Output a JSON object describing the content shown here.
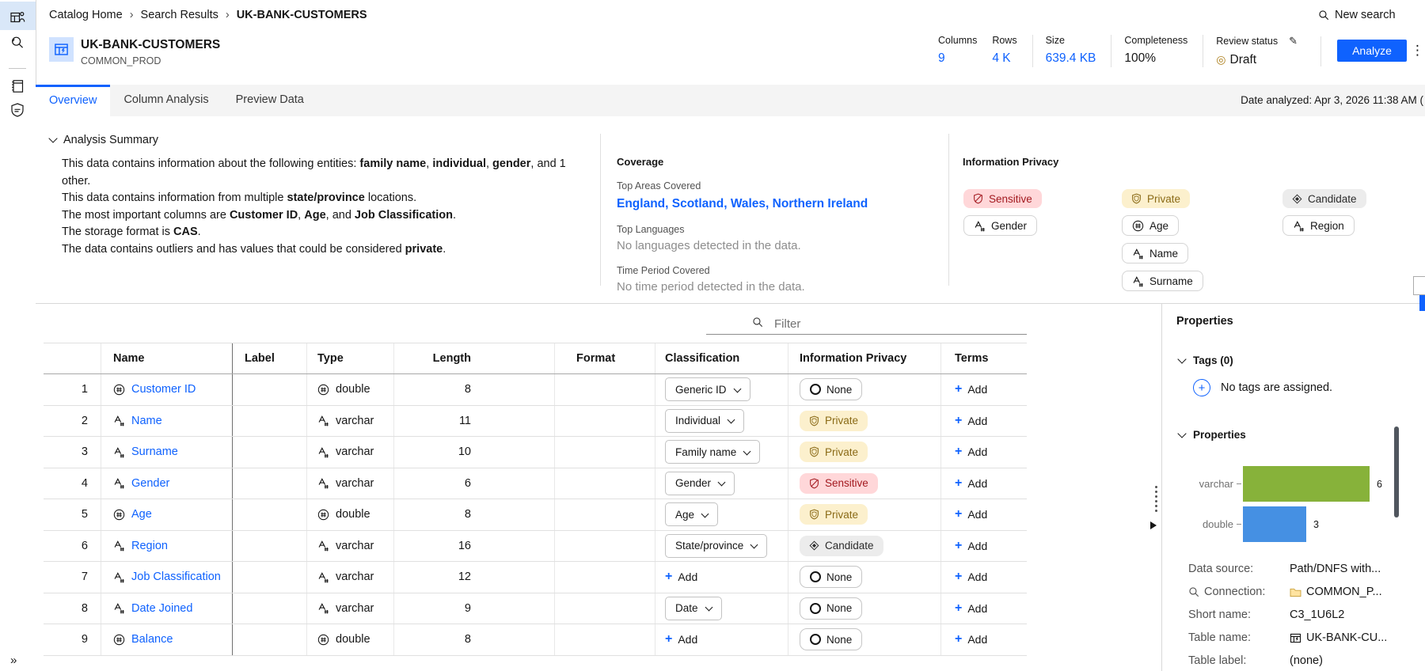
{
  "glyphs": {
    "breadcrumb_sep": "›",
    "kebab": "⋮",
    "pencil": "✎",
    "draft_icon": "◎",
    "expand": "»",
    "plus": "+"
  },
  "colors": {
    "accent": "#0f62fe",
    "sensitive_bg": "#ffd7d9",
    "sensitive_fg": "#a2191f",
    "private_bg": "#fcf0cd",
    "private_fg": "#8a6a16",
    "candidate_bg": "#ececec",
    "bar_green": "#87b23a",
    "bar_blue": "#4590e3",
    "scrollbar": "#50565e"
  },
  "sidebar": {
    "items": [
      {
        "id": "catalog",
        "icon": "catalog-icon",
        "selected": true
      },
      {
        "id": "discovery",
        "icon": "search-discovery-icon",
        "selected": false
      },
      {
        "id": "notebook",
        "icon": "notebook-icon",
        "selected": false
      },
      {
        "id": "governance",
        "icon": "governance-shield-icon",
        "selected": false
      }
    ],
    "expand_label": "»"
  },
  "breadcrumb": [
    "Catalog Home",
    "Search Results",
    "UK-BANK-CUSTOMERS"
  ],
  "top_right": {
    "new_search": "New search"
  },
  "header": {
    "title": "UK-BANK-CUSTOMERS",
    "subtitle": "COMMON_PROD",
    "stats": [
      {
        "label": "Columns",
        "value": "9",
        "link": true,
        "divider": false
      },
      {
        "label": "Rows",
        "value": "4 K",
        "link": true,
        "divider": false
      },
      {
        "label": "Size",
        "value": "639.4 KB",
        "link": true,
        "divider": true
      },
      {
        "label": "Completeness",
        "value": "100%",
        "link": false,
        "divider": true
      }
    ],
    "review_status": {
      "label": "Review status",
      "value": "Draft"
    },
    "analyze_button": "Analyze"
  },
  "tabs": [
    {
      "label": "Overview",
      "selected": true
    },
    {
      "label": "Column Analysis",
      "selected": false
    },
    {
      "label": "Preview Data",
      "selected": false
    }
  ],
  "date_analyzed": "Date analyzed: Apr 3, 2026 11:38 AM  (",
  "analysis_summary": {
    "title": "Analysis Summary",
    "lines": [
      [
        {
          "t": "This data contains information about the following entities: "
        },
        {
          "t": "family name",
          "b": true
        },
        {
          "t": ", "
        },
        {
          "t": "individual",
          "b": true
        },
        {
          "t": ", "
        },
        {
          "t": "gender",
          "b": true
        },
        {
          "t": ", and 1 other."
        }
      ],
      [
        {
          "t": "This data contains information from multiple "
        },
        {
          "t": "state/province",
          "b": true
        },
        {
          "t": " locations."
        }
      ],
      [
        {
          "t": "The most important columns are "
        },
        {
          "t": "Customer ID",
          "b": true
        },
        {
          "t": ", "
        },
        {
          "t": "Age",
          "b": true
        },
        {
          "t": ", and "
        },
        {
          "t": "Job Classification",
          "b": true
        },
        {
          "t": "."
        }
      ],
      [
        {
          "t": "The storage format is "
        },
        {
          "t": "CAS",
          "b": true
        },
        {
          "t": "."
        }
      ],
      [
        {
          "t": "The data contains outliers and has values that could be considered "
        },
        {
          "t": "private",
          "b": true
        },
        {
          "t": "."
        }
      ]
    ]
  },
  "coverage": {
    "title": "Coverage",
    "top_areas_label": "Top Areas Covered",
    "top_areas": "England, Scotland, Wales, Northern Ireland",
    "top_languages_label": "Top Languages",
    "top_languages": "No languages detected in the data.",
    "time_period_label": "Time Period Covered",
    "time_period": "No time period detected in the data."
  },
  "information_privacy": {
    "title": "Information Privacy",
    "columns": [
      [
        {
          "label": "Sensitive",
          "variant": "sensitive",
          "icon": "shield-slash-icon"
        },
        {
          "label": "Gender",
          "variant": "plain",
          "icon": "string-type-icon"
        }
      ],
      [
        {
          "label": "Private",
          "variant": "private",
          "icon": "shield-icon"
        },
        {
          "label": "Age",
          "variant": "plain",
          "icon": "numeric-type-icon"
        },
        {
          "label": "Name",
          "variant": "plain",
          "icon": "string-type-icon"
        },
        {
          "label": "Surname",
          "variant": "plain",
          "icon": "string-type-icon"
        }
      ],
      [
        {
          "label": "Candidate",
          "variant": "candidate",
          "icon": "diamond-icon"
        },
        {
          "label": "Region",
          "variant": "plain",
          "icon": "string-type-icon"
        }
      ]
    ]
  },
  "columns_table": {
    "filter_placeholder": "Filter",
    "headers": [
      "Name",
      "Label",
      "Type",
      "Length",
      "Format",
      "Classification",
      "Information Privacy",
      "Terms"
    ],
    "add_label": "Add",
    "rows": [
      {
        "num": "1",
        "name": "Customer ID",
        "type_kind": "numeric",
        "type": "double",
        "length": "8",
        "classification": {
          "kind": "select",
          "value": "Generic ID"
        },
        "privacy": {
          "label": "None",
          "variant": "none"
        }
      },
      {
        "num": "2",
        "name": "Name",
        "type_kind": "string",
        "type": "varchar",
        "length": "11",
        "classification": {
          "kind": "select",
          "value": "Individual"
        },
        "privacy": {
          "label": "Private",
          "variant": "private"
        }
      },
      {
        "num": "3",
        "name": "Surname",
        "type_kind": "string",
        "type": "varchar",
        "length": "10",
        "classification": {
          "kind": "select",
          "value": "Family name"
        },
        "privacy": {
          "label": "Private",
          "variant": "private"
        }
      },
      {
        "num": "4",
        "name": "Gender",
        "type_kind": "string",
        "type": "varchar",
        "length": "6",
        "classification": {
          "kind": "select",
          "value": "Gender"
        },
        "privacy": {
          "label": "Sensitive",
          "variant": "sensitive"
        }
      },
      {
        "num": "5",
        "name": "Age",
        "type_kind": "numeric",
        "type": "double",
        "length": "8",
        "classification": {
          "kind": "select",
          "value": "Age"
        },
        "privacy": {
          "label": "Private",
          "variant": "private"
        }
      },
      {
        "num": "6",
        "name": "Region",
        "type_kind": "string",
        "type": "varchar",
        "length": "16",
        "classification": {
          "kind": "select",
          "value": "State/province"
        },
        "privacy": {
          "label": "Candidate",
          "variant": "candidate"
        }
      },
      {
        "num": "7",
        "name": "Job Classification",
        "type_kind": "string",
        "type": "varchar",
        "length": "12",
        "classification": {
          "kind": "add"
        },
        "privacy": {
          "label": "None",
          "variant": "none"
        }
      },
      {
        "num": "8",
        "name": "Date Joined",
        "type_kind": "string",
        "type": "varchar",
        "length": "9",
        "classification": {
          "kind": "select",
          "value": "Date"
        },
        "privacy": {
          "label": "None",
          "variant": "none"
        }
      },
      {
        "num": "9",
        "name": "Balance",
        "type_kind": "numeric",
        "type": "double",
        "length": "8",
        "classification": {
          "kind": "add"
        },
        "privacy": {
          "label": "None",
          "variant": "none"
        }
      }
    ]
  },
  "properties_panel": {
    "title": "Properties",
    "tags_section": {
      "title": "Tags (0)",
      "empty_text": "No tags are assigned."
    },
    "properties_section": {
      "title": "Properties"
    },
    "chart_data": {
      "type": "bar",
      "orientation": "horizontal",
      "categories": [
        "varchar",
        "double"
      ],
      "values": [
        6,
        3
      ],
      "colors": [
        "#87b23a",
        "#4590e3"
      ],
      "xlim": [
        0,
        6
      ]
    },
    "fields": [
      {
        "label": "Data source:",
        "value": "Path/DNFS with...",
        "label_icon": null,
        "value_icon": null
      },
      {
        "label": "Connection:",
        "value": "COMMON_P...",
        "label_icon": "search-icon",
        "value_icon": "folder-icon"
      },
      {
        "label": "Short name:",
        "value": "C3_1U6L2",
        "label_icon": null,
        "value_icon": null
      },
      {
        "label": "Table name:",
        "value": "UK-BANK-CU...",
        "label_icon": null,
        "value_icon": "table-icon"
      },
      {
        "label": "Table label:",
        "value": "(none)",
        "label_icon": null,
        "value_icon": null
      }
    ]
  }
}
